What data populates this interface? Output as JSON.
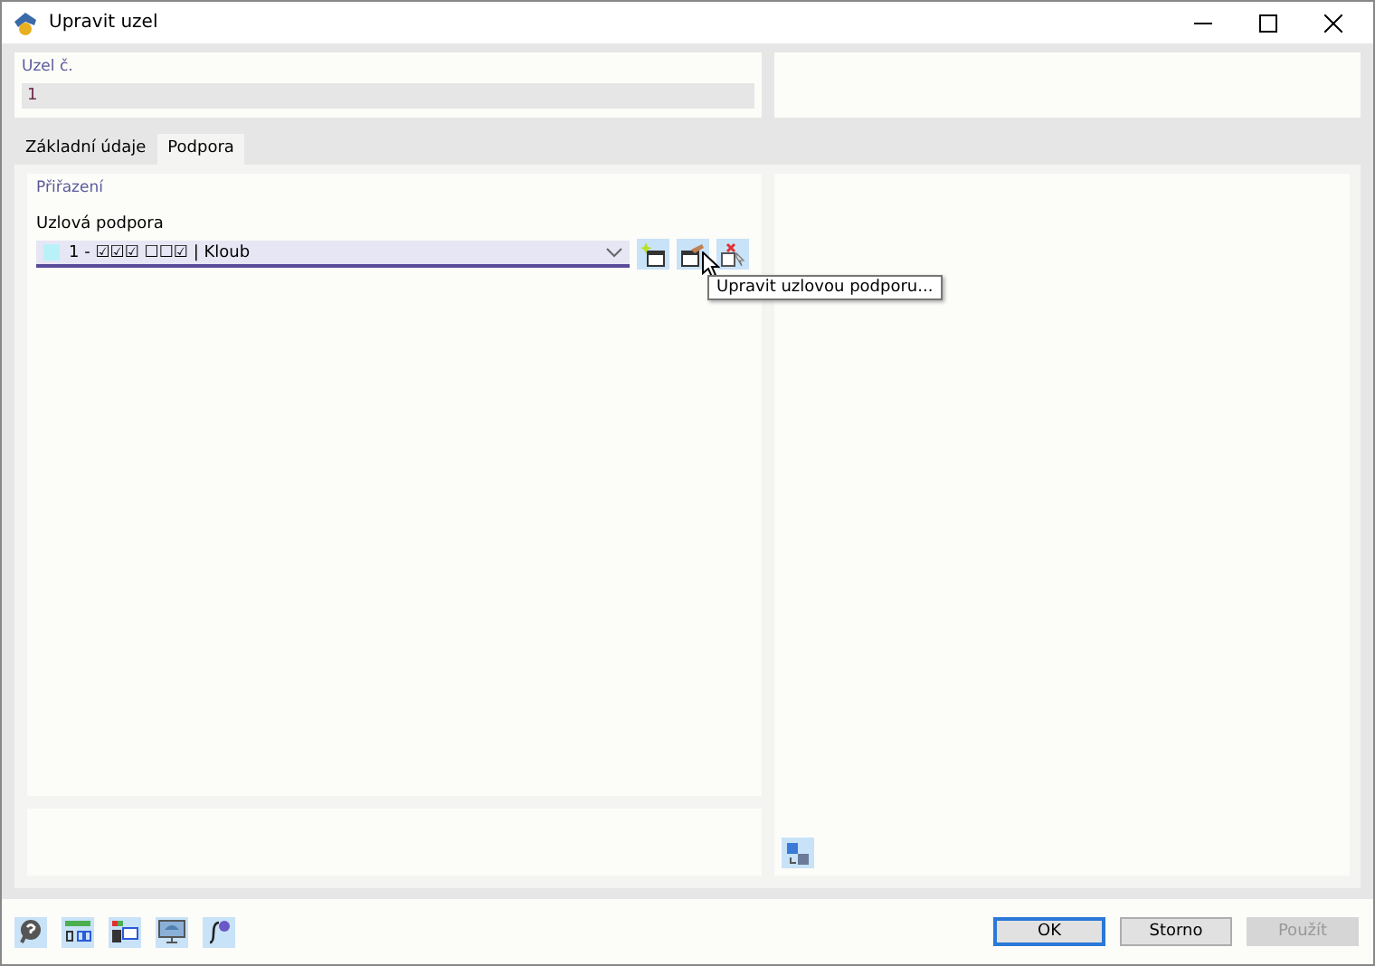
{
  "window": {
    "title": "Upravit uzel"
  },
  "node": {
    "label": "Uzel č.",
    "value": "1"
  },
  "tabs": [
    {
      "label": "Základní údaje",
      "selected": false
    },
    {
      "label": "Podpora",
      "selected": true
    }
  ],
  "assignment": {
    "title": "Přiřazení",
    "field_label": "Uzlová podpora",
    "value": "1 - ☑☑☑ ☐☐☑ | Kloub"
  },
  "tooltip": "Upravit uzlovou podporu...",
  "buttons": [
    {
      "label": "OK",
      "default": true,
      "disabled": false
    },
    {
      "label": "Storno",
      "default": false,
      "disabled": false
    },
    {
      "label": "Použít",
      "default": false,
      "disabled": true
    }
  ]
}
